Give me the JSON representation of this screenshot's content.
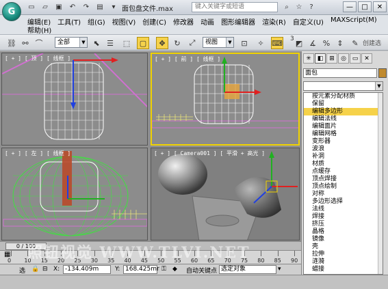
{
  "window": {
    "title": "面包盘文件.max",
    "search_placeholder": "键入关键字或短语",
    "min": "—",
    "max": "□",
    "close": "✕"
  },
  "menu": {
    "row1": [
      "编辑(E)",
      "工具(T)",
      "组(G)",
      "视图(V)",
      "创建(C)",
      "修改器",
      "动画",
      "图形编辑器",
      "渲染(R)",
      "自定义(U)",
      "MAXScript(M)"
    ],
    "row2": [
      "帮助(H)"
    ]
  },
  "toolbar": {
    "filter_select": "全部",
    "view_select": "视图",
    "snap_num": "3",
    "create_selection": "创建选"
  },
  "viewports": {
    "top_left": "[ + ] [ 顶 ] [ 线框 ]",
    "top_right": "[ + ] [ 前 ] [ 线框 ]",
    "bottom_left": "[ + ] [ 左 ] [ 线框 ]",
    "bottom_right": "[ + ] [ Camera001 ] [ 平滑 + 高光 ]"
  },
  "command_panel": {
    "object_name": "面包",
    "object_color": "#c08a2e",
    "modifier_select": "",
    "modifiers": [
      "按元素分配材质",
      "保留",
      "编辑多边形",
      "编辑法线",
      "编辑面片",
      "编辑网格",
      "变形器",
      "波浪",
      "补洞",
      "材质",
      "点缓存",
      "顶点焊接",
      "顶点绘制",
      "对称",
      "多边形选择",
      "法线",
      "焊接",
      "挤压",
      "晶格",
      "镜像",
      "壳",
      "拉伸",
      "涟漪",
      "蜡接"
    ],
    "selected_index": 2
  },
  "timeline": {
    "slider": "0 / 100",
    "ticks": [
      "0",
      "10",
      "15",
      "20",
      "25",
      "30",
      "35",
      "40",
      "45",
      "50",
      "55",
      "60",
      "65",
      "70",
      "75",
      "80",
      "85",
      "90"
    ]
  },
  "status": {
    "selection_label": "选",
    "x_label": "X:",
    "x_value": "-134.409m",
    "y_label": "Y:",
    "y_value": "168.425mr",
    "auto_key": "自动关键点",
    "selected_objects": "选定对象"
  },
  "watermark": "照钮视觉 WWW.TLVI.NET"
}
